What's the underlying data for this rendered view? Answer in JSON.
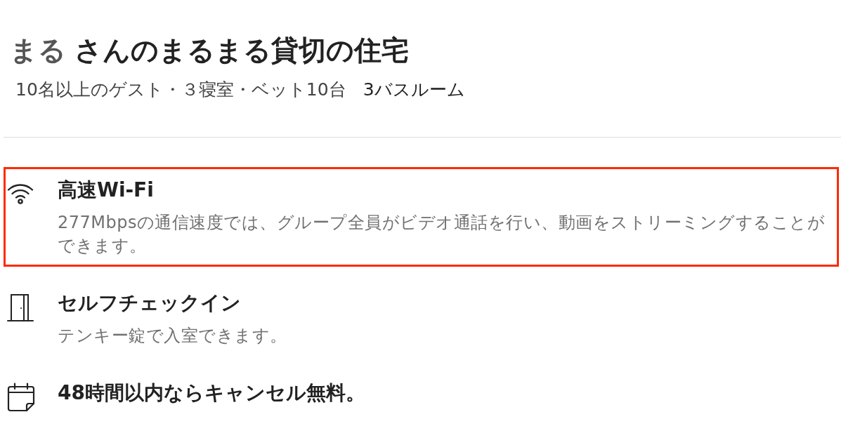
{
  "listing": {
    "host_name": "まる",
    "title": "さんのまるまる貸切の住宅"
  },
  "summary": {
    "details": "10名以上のゲスト・３寝室・ベット10台",
    "bathrooms": "3バスルーム"
  },
  "amenities": [
    {
      "kind": "wifi",
      "title": "高速Wi-Fi",
      "description": "277Mbpsの通信速度では、グループ全員がビデオ通話を行い、動画をストリーミングすることができます。",
      "highlighted": true
    },
    {
      "kind": "checkin",
      "title": "セルフチェックイン",
      "description": "テンキー錠で入室できます。",
      "highlighted": false
    },
    {
      "kind": "cancellation",
      "title": "48時間以内ならキャンセル無料。",
      "highlighted": false
    }
  ]
}
